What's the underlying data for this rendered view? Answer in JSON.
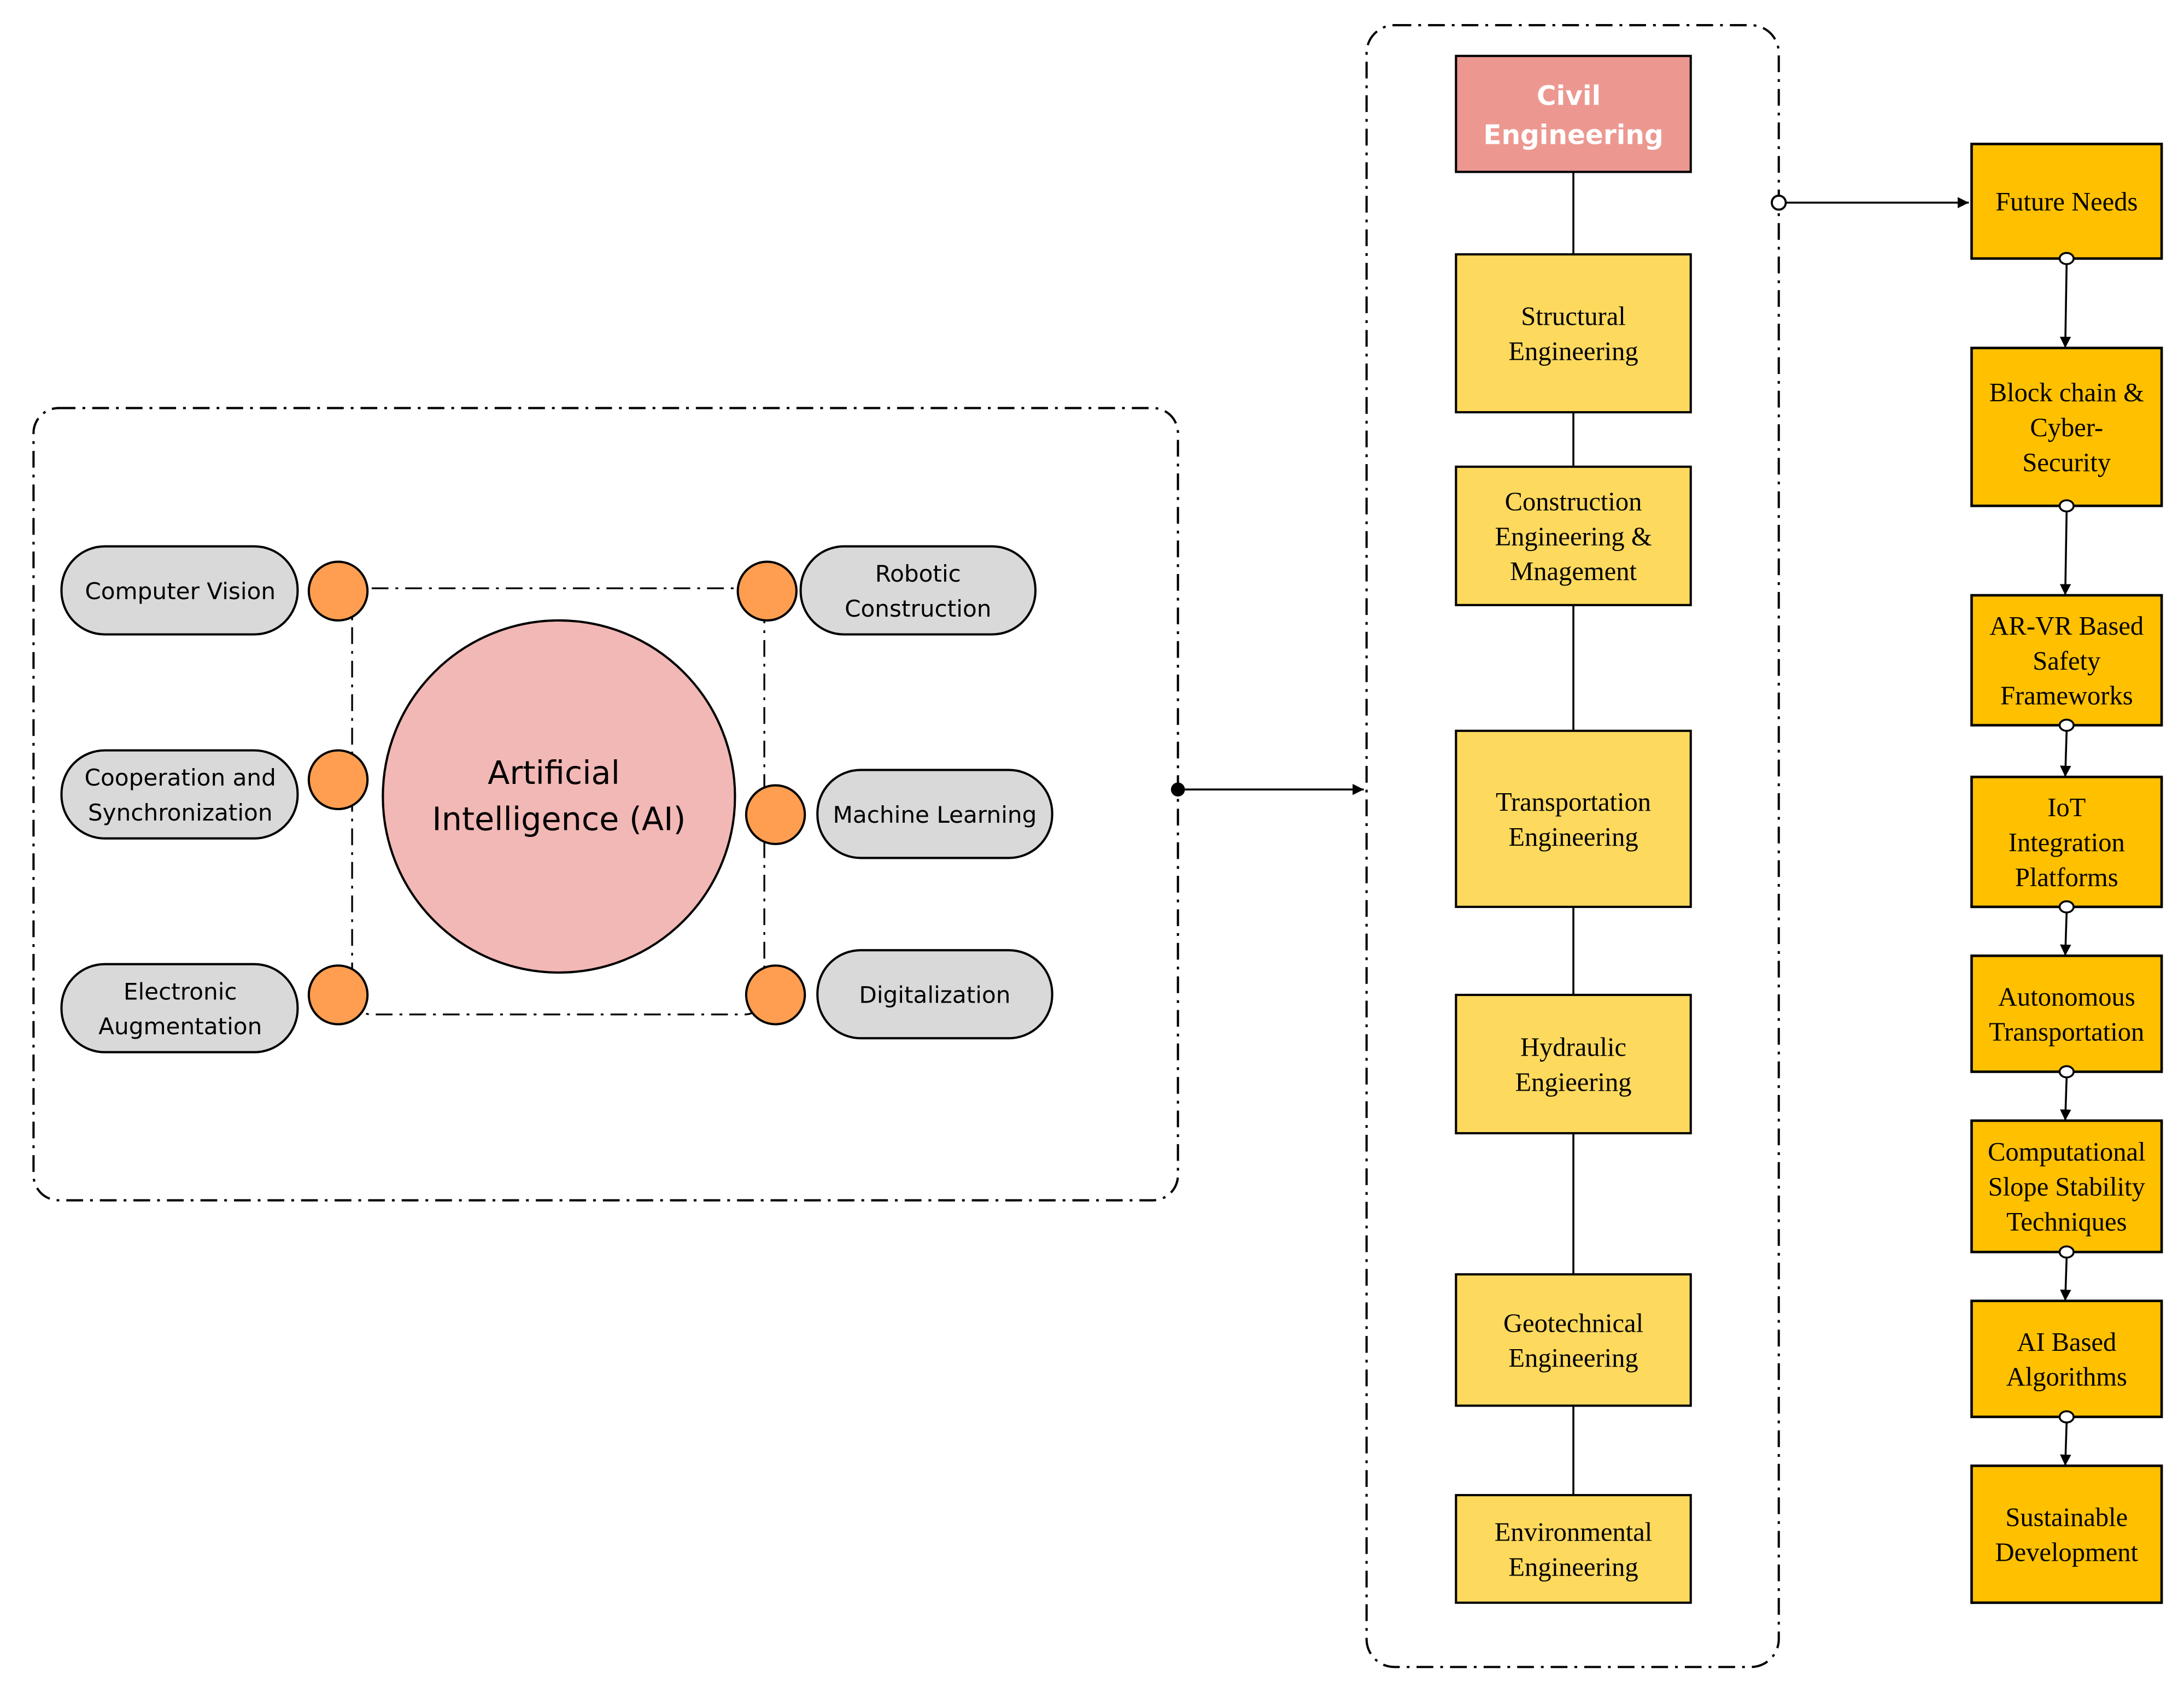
{
  "colors": {
    "ai_circle": "#F2B8B5",
    "civil_box": "#EC9891",
    "civil_text": "#FFFFFF",
    "branch_box": "#FDD95E",
    "future_box": "#FFC000",
    "pill": "#D9D9D9",
    "node": "#FF9E50",
    "stroke": "#000000"
  },
  "ai_cluster": {
    "center": {
      "line1": "Artificial",
      "line2": "Intelligence (AI)"
    },
    "left": [
      {
        "lines": [
          "Computer Vision"
        ]
      },
      {
        "lines": [
          "Cooperation and",
          "Synchronization"
        ]
      },
      {
        "lines": [
          "Electronic",
          "Augmentation"
        ]
      }
    ],
    "right": [
      {
        "lines": [
          "Robotic",
          "Construction"
        ]
      },
      {
        "lines": [
          "Machine Learning"
        ]
      },
      {
        "lines": [
          "Digitalization"
        ]
      }
    ]
  },
  "civil": {
    "root": {
      "lines": [
        "Civil",
        "Engineering"
      ]
    },
    "branches": [
      {
        "lines": [
          "Structural",
          "Engineering"
        ]
      },
      {
        "lines": [
          "Construction",
          "Engineering &",
          "Mnagement"
        ]
      },
      {
        "lines": [
          "Transportation",
          "Engineering"
        ]
      },
      {
        "lines": [
          "Hydraulic",
          "Engieering"
        ]
      },
      {
        "lines": [
          "Geotechnical",
          "Engineering"
        ]
      },
      {
        "lines": [
          "Environmental",
          "Engineering"
        ]
      }
    ]
  },
  "future": {
    "items": [
      {
        "lines": [
          "Future Needs"
        ]
      },
      {
        "lines": [
          "Block chain &",
          "Cyber-",
          "Security"
        ]
      },
      {
        "lines": [
          "AR-VR Based",
          "Safety",
          "Frameworks"
        ]
      },
      {
        "lines": [
          "IoT",
          "Integration",
          "Platforms"
        ]
      },
      {
        "lines": [
          "Autonomous",
          "Transportation"
        ]
      },
      {
        "lines": [
          "Computational",
          "Slope Stability",
          "Techniques"
        ]
      },
      {
        "lines": [
          "AI Based",
          "Algorithms"
        ]
      },
      {
        "lines": [
          "Sustainable",
          "Development"
        ]
      }
    ]
  }
}
